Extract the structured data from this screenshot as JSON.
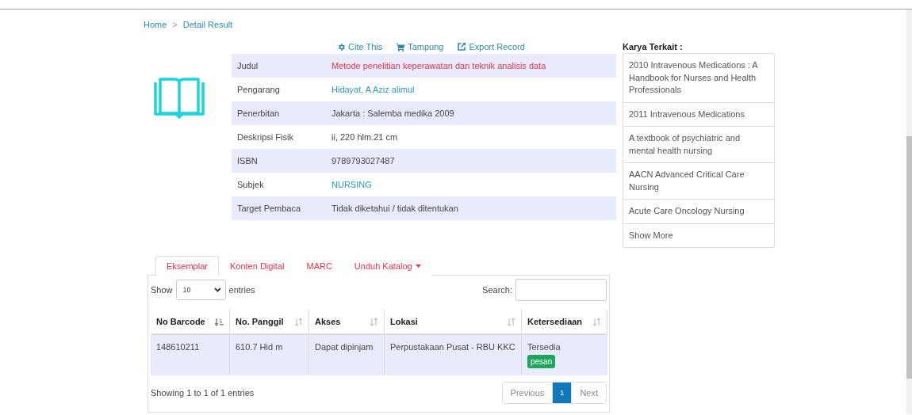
{
  "breadcrumb": [
    "Home",
    "Detail Result"
  ],
  "breadcrumb_separator": ">",
  "actions": [
    {
      "kind": "cite",
      "label": "Cite This"
    },
    {
      "kind": "cart",
      "label": "Tampung"
    },
    {
      "kind": "export",
      "label": "Export Record"
    }
  ],
  "details": [
    {
      "label": "Judul",
      "value": "Metode penelitian keperawatan dan teknik analisis data",
      "kind": "title"
    },
    {
      "label": "Pengarang",
      "value": "Hidayat, A Aziz alimul",
      "kind": "link"
    },
    {
      "label": "Penerbitan",
      "value": "Jakarta : Salemba medika 2009",
      "kind": "text"
    },
    {
      "label": "Deskripsi Fisik",
      "value": "ii, 220 hlm.21 cm",
      "kind": "text"
    },
    {
      "label": "ISBN",
      "value": "9789793027487",
      "kind": "text"
    },
    {
      "label": "Subjek",
      "value": "NURSING",
      "kind": "link"
    },
    {
      "label": "Target Pembaca",
      "value": "Tidak diketahui / tidak ditentukan",
      "kind": "text"
    }
  ],
  "related": {
    "title": "Karya Terkait :",
    "items": [
      "2010 Intravenous Medications : A Handbook for Nurses and Health Professionals",
      "2011 Intravenous Medications",
      "A textbook of psychiatric and mental health nursing",
      "AACN Advanced Critical Care Nursing",
      "Acute Care Oncology Nursing",
      "Show More"
    ]
  },
  "tabs": [
    {
      "label": "Eksemplar",
      "selected": true,
      "dropdown": false
    },
    {
      "label": "Konten Digital",
      "selected": false,
      "dropdown": false
    },
    {
      "label": "MARC",
      "selected": false,
      "dropdown": false
    },
    {
      "label": "Unduh Katalog",
      "selected": false,
      "dropdown": true
    }
  ],
  "table": {
    "length_label_before": "Show",
    "length_value": "10",
    "length_label_after": "entries",
    "search_label": "Search:",
    "columns": [
      {
        "label": "No Barcode",
        "sorted": true
      },
      {
        "label": "No. Panggil",
        "sorted": false
      },
      {
        "label": "Akses",
        "sorted": false
      },
      {
        "label": "Lokasi",
        "sorted": false
      },
      {
        "label": "Ketersediaan",
        "sorted": false
      }
    ],
    "rows": [
      {
        "cells": [
          "148610211",
          "610.7 Hid m",
          "Dapat dipinjam",
          "Perpustakaan Pusat - RBU KKC",
          "Tersedia"
        ],
        "badge": "pesan"
      }
    ],
    "info": "Showing 1 to 1 of 1 entries",
    "pagination": [
      {
        "label": "Previous",
        "selected": false
      },
      {
        "label": "1",
        "selected": true
      },
      {
        "label": "Next",
        "selected": false
      }
    ]
  }
}
